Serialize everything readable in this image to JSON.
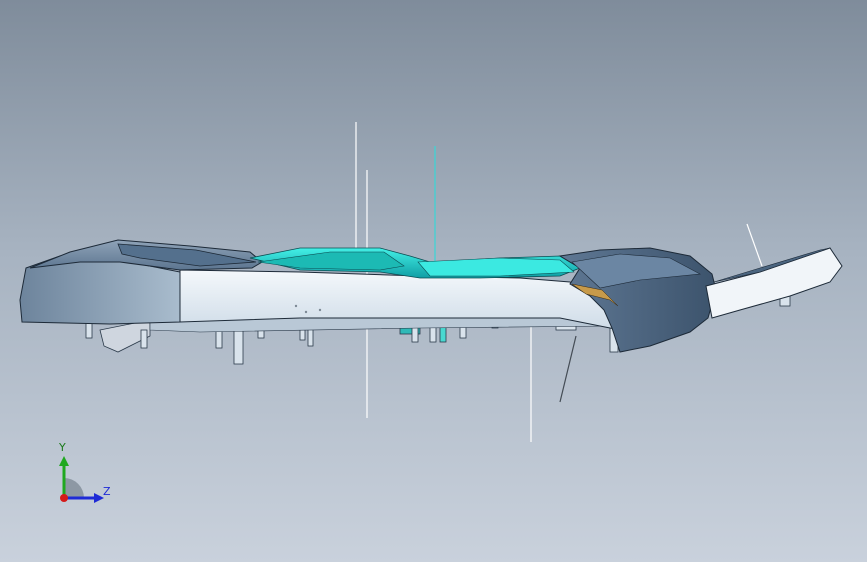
{
  "viewport": {
    "background_top": "#7f8c9b",
    "background_bottom": "#c9d1dc"
  },
  "model": {
    "body_color": "#7b91a8",
    "body_dark": "#4e6580",
    "face_color": "#e9f1f7",
    "accent_color": "#2ce0d8",
    "accent_dark": "#1aa6a8",
    "edge_color": "#1d2a38",
    "leader_color": "#ffffff"
  },
  "triad": {
    "y_label": "Y",
    "z_label": "Z",
    "y_color": "#1fa81f",
    "z_color": "#1e2ad6",
    "x_color": "#d41a1a"
  }
}
